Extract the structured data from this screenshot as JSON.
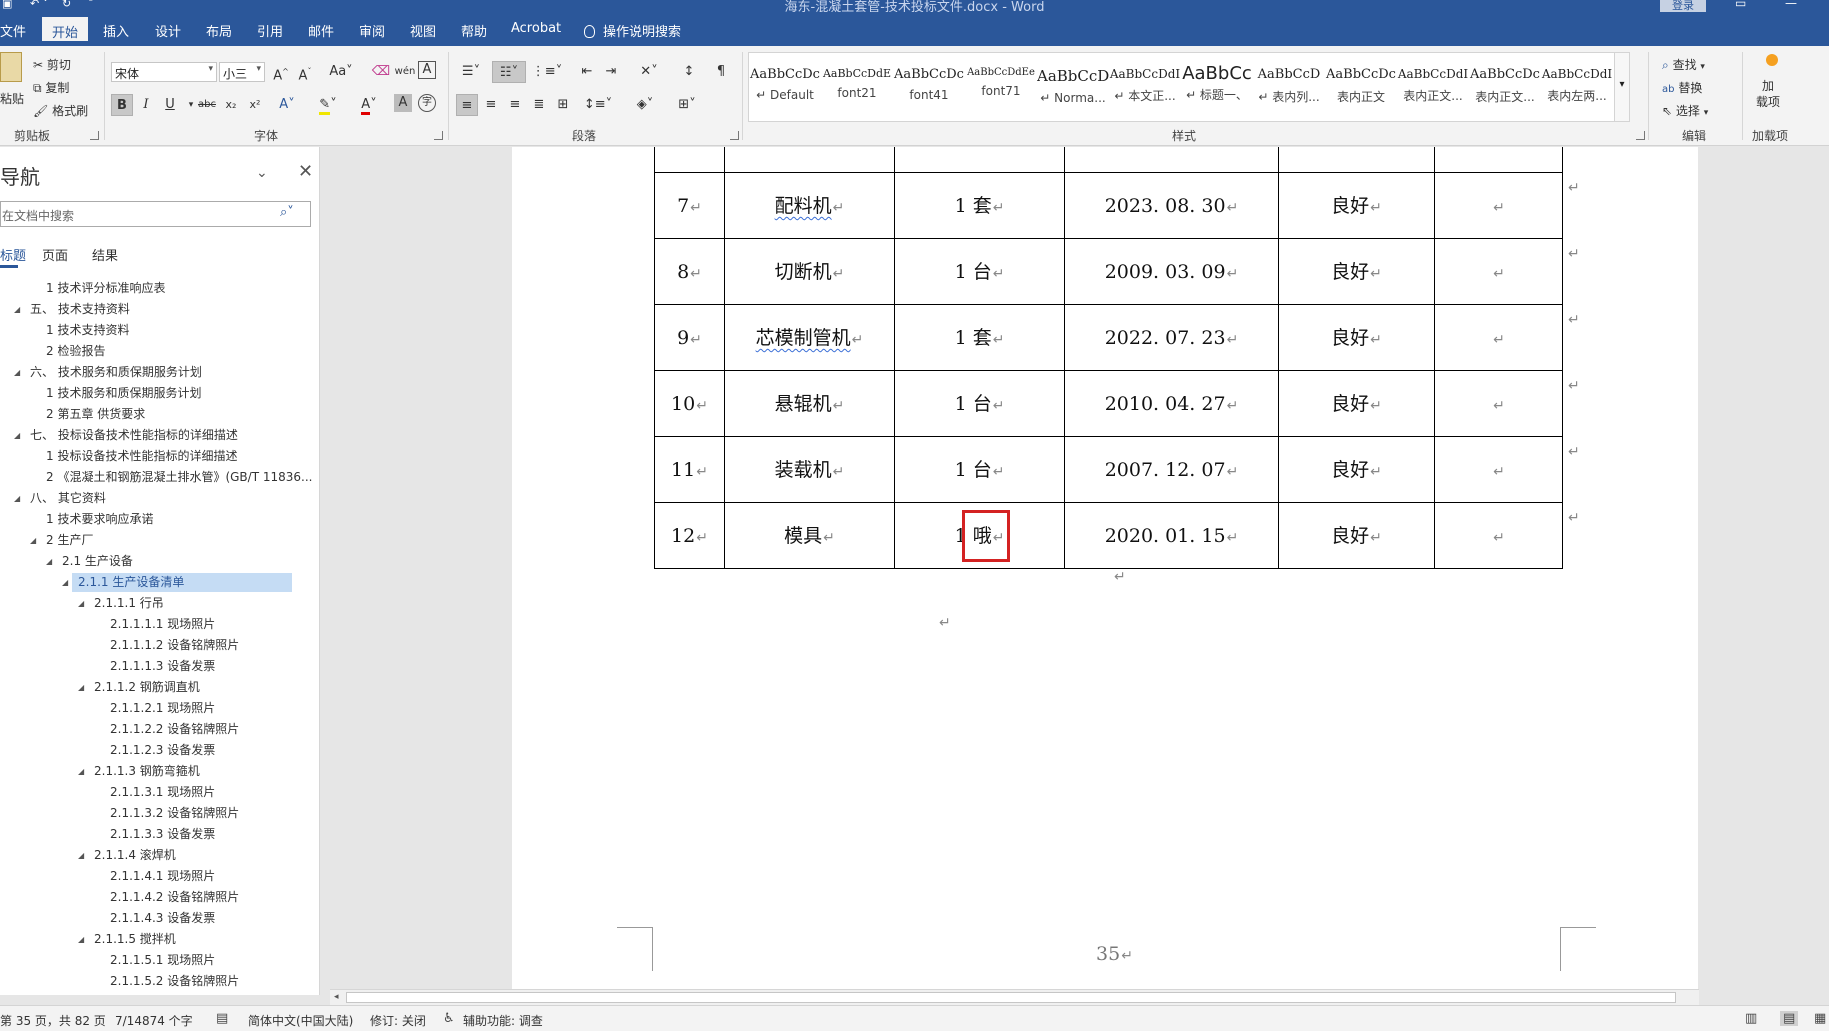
{
  "window": {
    "title": "海东-混凝土套管-技术投标文件.docx  -  Word",
    "login_label": "登录"
  },
  "tabs": [
    "文件",
    "开始",
    "插入",
    "设计",
    "布局",
    "引用",
    "邮件",
    "审阅",
    "视图",
    "帮助",
    "Acrobat"
  ],
  "tell_me": "操作说明搜索",
  "ribbon": {
    "clipboard": {
      "paste": "粘贴",
      "cut": "剪切",
      "copy": "复制",
      "format_painter": "格式刷",
      "label": "剪贴板"
    },
    "font": {
      "font_name": "宋体",
      "font_size": "小三",
      "label": "字体"
    },
    "paragraph": {
      "label": "段落"
    },
    "styles": {
      "label": "样式",
      "items": [
        {
          "sample": "AaBbCcDc",
          "name": "↵ Default"
        },
        {
          "sample": "AaBbCcDdE",
          "name": "font21"
        },
        {
          "sample": "AaBbCcDc",
          "name": "font41"
        },
        {
          "sample": "AaBbCcDdEe",
          "name": "font71"
        },
        {
          "sample": "AaBbCcD",
          "name": "↵ Norma..."
        },
        {
          "sample": "AaBbCcDdI",
          "name": "↵ 本文正..."
        },
        {
          "sample": "AaBbCc",
          "name": "↵ 标题一、"
        },
        {
          "sample": "AaBbCcD",
          "name": "↵ 表内列..."
        },
        {
          "sample": "AaBbCcDc",
          "name": "表内正文"
        },
        {
          "sample": "AaBbCcDdI",
          "name": "表内正文..."
        },
        {
          "sample": "AaBbCcDc",
          "name": "表内正文..."
        },
        {
          "sample": "AaBbCcDdI",
          "name": "表内左两..."
        }
      ]
    },
    "editing": {
      "find": "查找",
      "replace": "替换",
      "select": "选择",
      "label": "编辑"
    },
    "addins": {
      "button": "加\n载项",
      "label": "加载项"
    }
  },
  "nav": {
    "title": "导航",
    "search_placeholder": "在文档中搜索",
    "tabs": [
      "标题",
      "页面",
      "结果"
    ],
    "items": [
      {
        "text": "1 技术评分标准响应表",
        "level": 1,
        "tri": ""
      },
      {
        "text": "五、 技术支持资料",
        "level": 0,
        "tri": "◢"
      },
      {
        "text": "1 技术支持资料",
        "level": 1,
        "tri": ""
      },
      {
        "text": "2 检验报告",
        "level": 1,
        "tri": ""
      },
      {
        "text": "六、 技术服务和质保期服务计划",
        "level": 0,
        "tri": "◢"
      },
      {
        "text": "1 技术服务和质保期服务计划",
        "level": 1,
        "tri": ""
      },
      {
        "text": "2 第五章  供货要求",
        "level": 1,
        "tri": ""
      },
      {
        "text": "七、 投标设备技术性能指标的详细描述",
        "level": 0,
        "tri": "◢"
      },
      {
        "text": "1 投标设备技术性能指标的详细描述",
        "level": 1,
        "tri": ""
      },
      {
        "text": "2 《混凝土和钢筋混凝土排水管》(GB/T 11836...",
        "level": 1,
        "tri": ""
      },
      {
        "text": "八、 其它资料",
        "level": 0,
        "tri": "◢"
      },
      {
        "text": "1 技术要求响应承诺",
        "level": 1,
        "tri": ""
      },
      {
        "text": "2 生产厂",
        "level": 1,
        "tri": "◢"
      },
      {
        "text": "2.1 生产设备",
        "level": 2,
        "tri": "◢"
      },
      {
        "text": "2.1.1 生产设备清单",
        "level": 3,
        "tri": "◢",
        "selected": true
      },
      {
        "text": "2.1.1.1 行吊",
        "level": 4,
        "tri": "◢"
      },
      {
        "text": "2.1.1.1.1 现场照片",
        "level": 5,
        "tri": ""
      },
      {
        "text": "2.1.1.1.2 设备铭牌照片",
        "level": 5,
        "tri": ""
      },
      {
        "text": "2.1.1.1.3 设备发票",
        "level": 5,
        "tri": ""
      },
      {
        "text": "2.1.1.2 钢筋调直机",
        "level": 4,
        "tri": "◢"
      },
      {
        "text": "2.1.1.2.1 现场照片",
        "level": 5,
        "tri": ""
      },
      {
        "text": "2.1.1.2.2 设备铭牌照片",
        "level": 5,
        "tri": ""
      },
      {
        "text": "2.1.1.2.3 设备发票",
        "level": 5,
        "tri": ""
      },
      {
        "text": "2.1.1.3 钢筋弯箍机",
        "level": 4,
        "tri": "◢"
      },
      {
        "text": "2.1.1.3.1 现场照片",
        "level": 5,
        "tri": ""
      },
      {
        "text": "2.1.1.3.2 设备铭牌照片",
        "level": 5,
        "tri": ""
      },
      {
        "text": "2.1.1.3.3 设备发票",
        "level": 5,
        "tri": ""
      },
      {
        "text": "2.1.1.4 滚焊机",
        "level": 4,
        "tri": "◢"
      },
      {
        "text": "2.1.1.4.1 现场照片",
        "level": 5,
        "tri": ""
      },
      {
        "text": "2.1.1.4.2 设备铭牌照片",
        "level": 5,
        "tri": ""
      },
      {
        "text": "2.1.1.4.3 设备发票",
        "level": 5,
        "tri": ""
      },
      {
        "text": "2.1.1.5 搅拌机",
        "level": 4,
        "tri": "◢"
      },
      {
        "text": "2.1.1.5.1 现场照片",
        "level": 5,
        "tri": ""
      },
      {
        "text": "2.1.1.5.2 设备铭牌照片",
        "level": 5,
        "tri": ""
      }
    ]
  },
  "table": {
    "rows": [
      {
        "no": "",
        "name": "",
        "qty": "",
        "date": "",
        "status": "",
        "remark": "",
        "partial": true
      },
      {
        "no": "7",
        "name": "配料机",
        "qty": "1 套",
        "date": "2023. 08. 30",
        "status": "良好",
        "remark": "",
        "squiggle": true
      },
      {
        "no": "8",
        "name": "切断机",
        "qty": "1 台",
        "date": "2009. 03. 09",
        "status": "良好",
        "remark": ""
      },
      {
        "no": "9",
        "name": "芯模制管机",
        "qty": "1 套",
        "date": "2022. 07. 23",
        "status": "良好",
        "remark": "",
        "squiggle": true
      },
      {
        "no": "10",
        "name": "悬辊机",
        "qty": "1 台",
        "date": "2010. 04. 27",
        "status": "良好",
        "remark": ""
      },
      {
        "no": "11",
        "name": "装载机",
        "qty": "1 台",
        "date": "2007. 12. 07",
        "status": "良好",
        "remark": ""
      },
      {
        "no": "12",
        "name": "模具",
        "qty": "1 哦",
        "date": "2020. 01. 15",
        "status": "良好",
        "remark": ""
      }
    ]
  },
  "page_number": "35",
  "status": {
    "page": "第 35 页，共 82 页",
    "words": "7/14874 个字",
    "language": "简体中文(中国大陆)",
    "track": "修订: 关闭",
    "accessibility": "辅助功能: 调查"
  }
}
